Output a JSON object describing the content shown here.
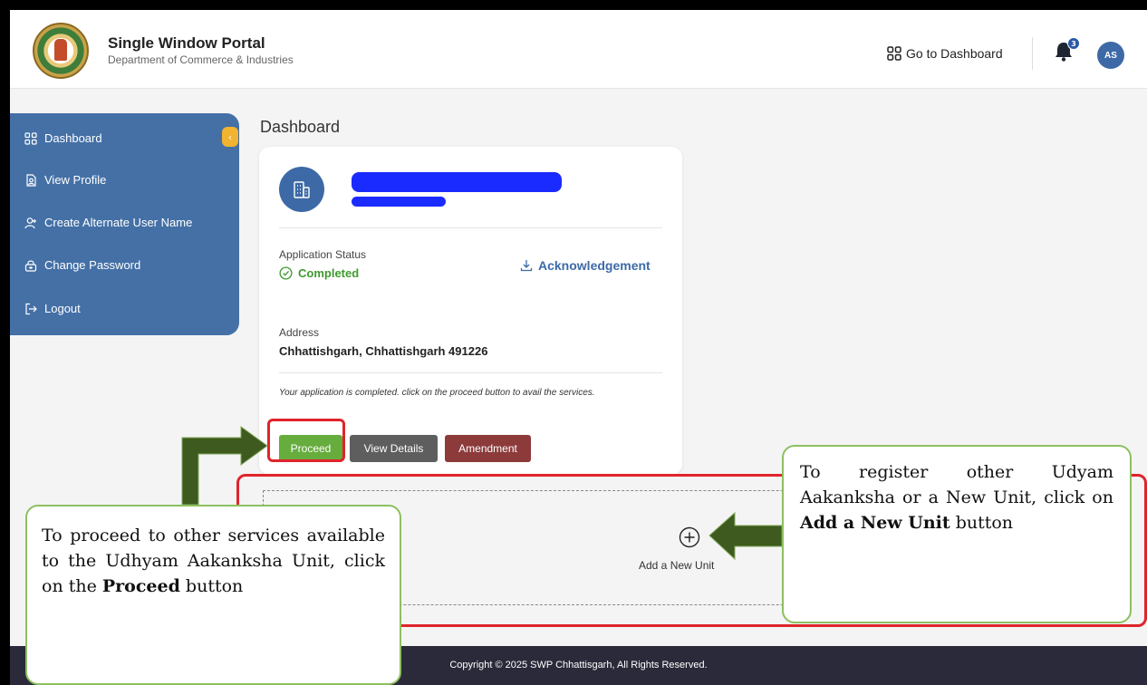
{
  "header": {
    "portal_title": "Single Window Portal",
    "portal_subtitle": "Department of Commerce & Industries",
    "goto_dashboard": "Go to Dashboard",
    "notification_count": "3",
    "avatar_initials": "AS"
  },
  "sidebar": {
    "items": [
      {
        "label": "Dashboard",
        "icon": "grid-icon"
      },
      {
        "label": "View Profile",
        "icon": "profile-doc-icon"
      },
      {
        "label": "Create Alternate User Name",
        "icon": "add-user-icon"
      },
      {
        "label": "Change Password",
        "icon": "lock-icon"
      },
      {
        "label": "Logout",
        "icon": "logout-icon"
      }
    ],
    "collapse_glyph": "‹"
  },
  "main": {
    "page_title": "Dashboard",
    "card": {
      "status_label": "Application Status",
      "status_value": "Completed",
      "acknowledgement": "Acknowledgement",
      "address_label": "Address",
      "address_value": "Chhattishgarh, Chhattishgarh 491226",
      "note": "Your application is completed. click on the proceed button to avail the services.",
      "buttons": {
        "proceed": "Proceed",
        "view_details": "View Details",
        "amendment": "Amendment"
      }
    },
    "add_unit_label": "Add a New Unit"
  },
  "footer": {
    "copyright": "Copyright © 2025 SWP Chhattisgarh, All Rights Reserved."
  },
  "annotations": {
    "left": {
      "text_before": "To proceed to other services available to the Udhyam Aakanksha Unit, click on the ",
      "bold": "Proceed",
      "text_after": " button"
    },
    "right": {
      "text_before": "To register other Udyam Aakanksha or a New Unit, click on ",
      "bold": "Add a New Unit",
      "text_after": " button"
    }
  },
  "colors": {
    "primary": "#4470a6",
    "success": "#66ad3d",
    "danger_highlight": "#e0242b",
    "callout_border": "#8dc060",
    "arrow": "#3e5a1e"
  }
}
